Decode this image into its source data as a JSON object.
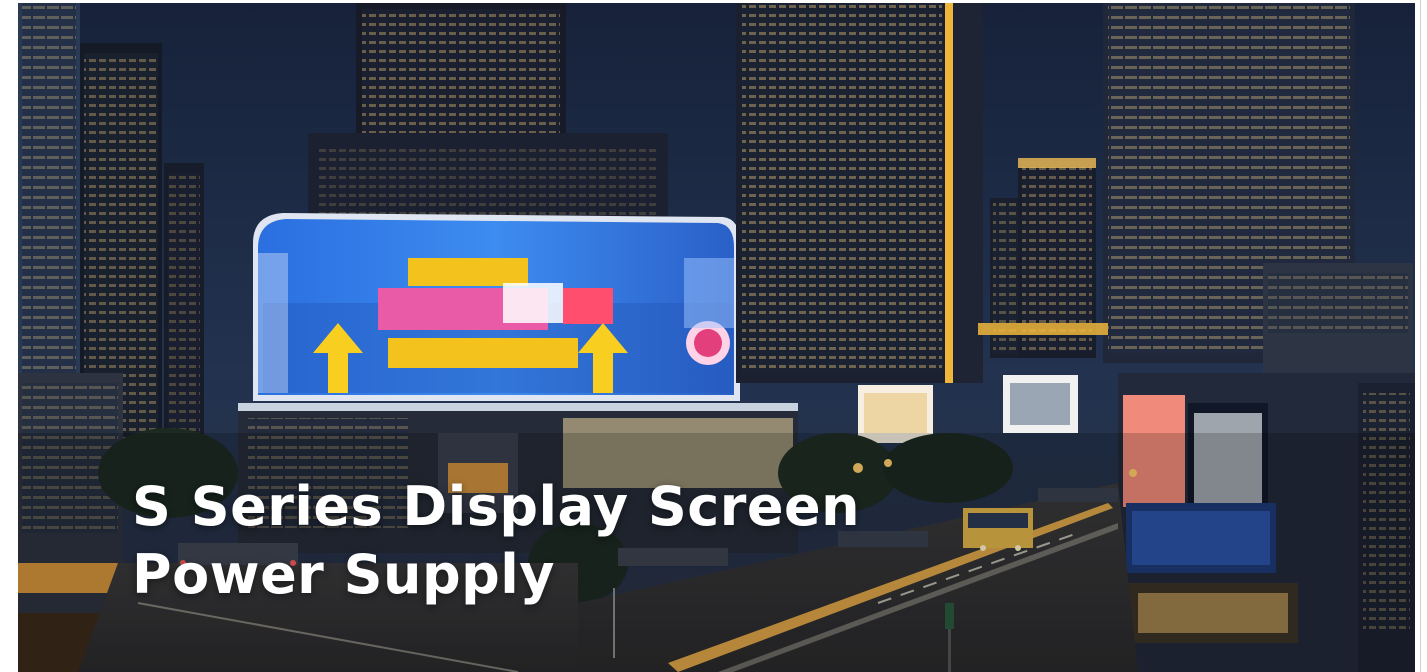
{
  "hero": {
    "title_line1": "S Series Display Screen",
    "title_line2": "Power Supply",
    "image_description_name": "night-city-billboard-photo"
  },
  "colors": {
    "sky": "#1d2b46",
    "screen_blue": "#2f74d9",
    "screen_yellow": "#f4c21d",
    "street_light": "#f2b24a",
    "title_text": "#ffffff"
  }
}
